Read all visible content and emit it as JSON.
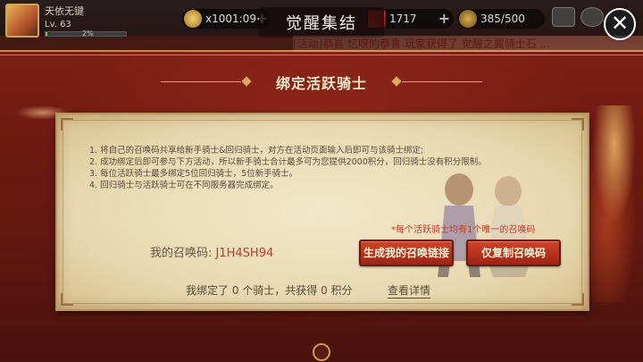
{
  "hud": {
    "player_name": "天依无键",
    "player_level": "Lv. 63",
    "exp_percent": "2%",
    "exp_fraction": 0.02,
    "resource1": "x1001:09",
    "resource2": "1717",
    "resource3": "385/500"
  },
  "title": "觉醒集结",
  "ticker": "[活动]恭喜 忆呀的恭喜 玩家获得了 觉醒之翼骑士石 ...",
  "section": {
    "title": "绑定活跃骑士"
  },
  "rules": [
    "1. 将自己的召唤码共享给新手骑士&回归骑士，对方在活动页面输入后即可与该骑士绑定;",
    "2. 成功绑定后即可参与下方活动，所以新手骑士合计最多可为您提供2000积分，回归骑士没有积分限制。",
    "3. 每位活跃骑士最多绑定5位回归骑士，5位新手骑士。",
    "4. 回归骑士与活跃骑士可在不同服务器完成绑定。"
  ],
  "note": "*每个活跃骑士均有1个唯一的召唤码",
  "code": {
    "label": "我的召唤码: ",
    "value": "J1H4SH94"
  },
  "buttons": {
    "generate": "生成我的召唤链接",
    "copy": "仅复制召唤码"
  },
  "stats": "我绑定了 0 个骑士，共获得 0 积分",
  "details": "查看详情",
  "colors": {
    "accent_red": "#c23a2a",
    "frame_red": "#7a1e14",
    "parchment": "#e8d8b0"
  }
}
